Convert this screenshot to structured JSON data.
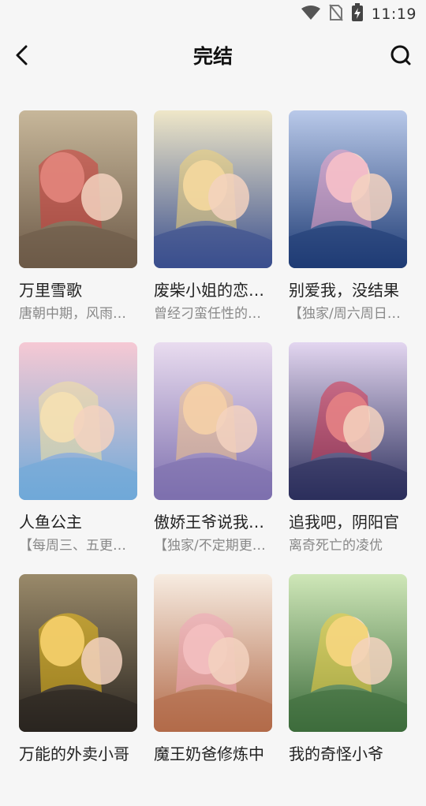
{
  "status": {
    "time": "11:19"
  },
  "header": {
    "title": "完结"
  },
  "comics": [
    {
      "title": "万里雪歌",
      "desc": "唐朝中期，风雨飘摇",
      "bg1": "#c7b79a",
      "bg2": "#6d5a48",
      "accent": "#cf3b3b"
    },
    {
      "title": "废柴小姐的恋爱生存",
      "desc": "曾经刁蛮任性的大小姐",
      "bg1": "#efe7c8",
      "bg2": "#3a4f8e",
      "accent": "#f0d47a"
    },
    {
      "title": "别爱我，没结果",
      "desc": "【独家/周六周日更新】",
      "bg1": "#b9c9e9",
      "bg2": "#1f3c75",
      "accent": "#f4a6c8"
    },
    {
      "title": "人鱼公主",
      "desc": "【每周三、五更新】",
      "bg1": "#f6c9d4",
      "bg2": "#6fa9d8",
      "accent": "#f3e2a0"
    },
    {
      "title": "傲娇王爷说我是他的",
      "desc": "【独家/不定期更新】",
      "bg1": "#e9dcef",
      "bg2": "#7d6fae",
      "accent": "#f2c48c"
    },
    {
      "title": "追我吧，阴阳官",
      "desc": "离奇死亡的凌优",
      "bg1": "#e3d6f0",
      "bg2": "#2c2f5c",
      "accent": "#d4334a"
    },
    {
      "title": "万能的外卖小哥",
      "desc": "",
      "bg1": "#9a8a6a",
      "bg2": "#2a2520",
      "accent": "#f2c21c"
    },
    {
      "title": "魔王奶爸修炼中",
      "desc": "",
      "bg1": "#f7ece1",
      "bg2": "#b26b4a",
      "accent": "#f0a6b8"
    },
    {
      "title": "我的奇怪小爷",
      "desc": "",
      "bg1": "#cfe7b8",
      "bg2": "#3d6c3c",
      "accent": "#f4d03f"
    }
  ]
}
